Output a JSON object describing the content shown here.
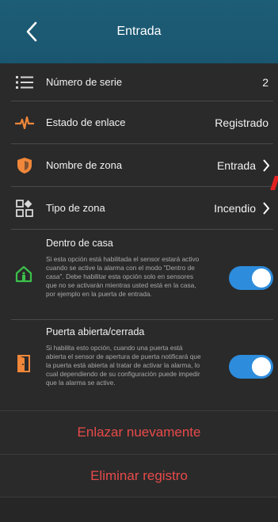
{
  "header": {
    "title": "Entrada"
  },
  "rows": [
    {
      "icon": "list-icon",
      "label": "Número de serie",
      "value": "2"
    },
    {
      "icon": "pulse-icon",
      "label": "Estado de enlace",
      "value": "Registrado"
    },
    {
      "icon": "shield-icon",
      "label": "Nombre de zona",
      "value": "Entrada"
    },
    {
      "icon": "zone-type-icon",
      "label": "Tipo de zona",
      "value": "Incendio"
    }
  ],
  "toggles": [
    {
      "icon": "home-icon",
      "title": "Dentro de casa",
      "description": "Si esta opción está habilitada el sensor estará activo cuando se active la alarma con el modo \"Dentro de casa\". Debe habilitar esta opción solo en sensores que no se activarán mientras usted está en la casa, por ejemplo en la puerta de entrada.",
      "enabled": true
    },
    {
      "icon": "door-icon",
      "title": "Puerta abierta/cerrada",
      "description": "Si habilita esto opción, cuando una puerta está abierta el sensor de apertura de puerta notificará que la puerta está abierta al tratar de activar la alarma, lo cual dependiendo de su configuración puede impedir que la alarma se active.",
      "enabled": true
    }
  ],
  "actions": {
    "relink": "Enlazar nuevamente",
    "delete": "Eliminar registro"
  },
  "colors": {
    "header_bg": "#1e5d76",
    "accent_orange": "#f0873a",
    "accent_green": "#3cc04a",
    "toggle_on": "#2d8cdc",
    "danger": "#e84a4a"
  }
}
